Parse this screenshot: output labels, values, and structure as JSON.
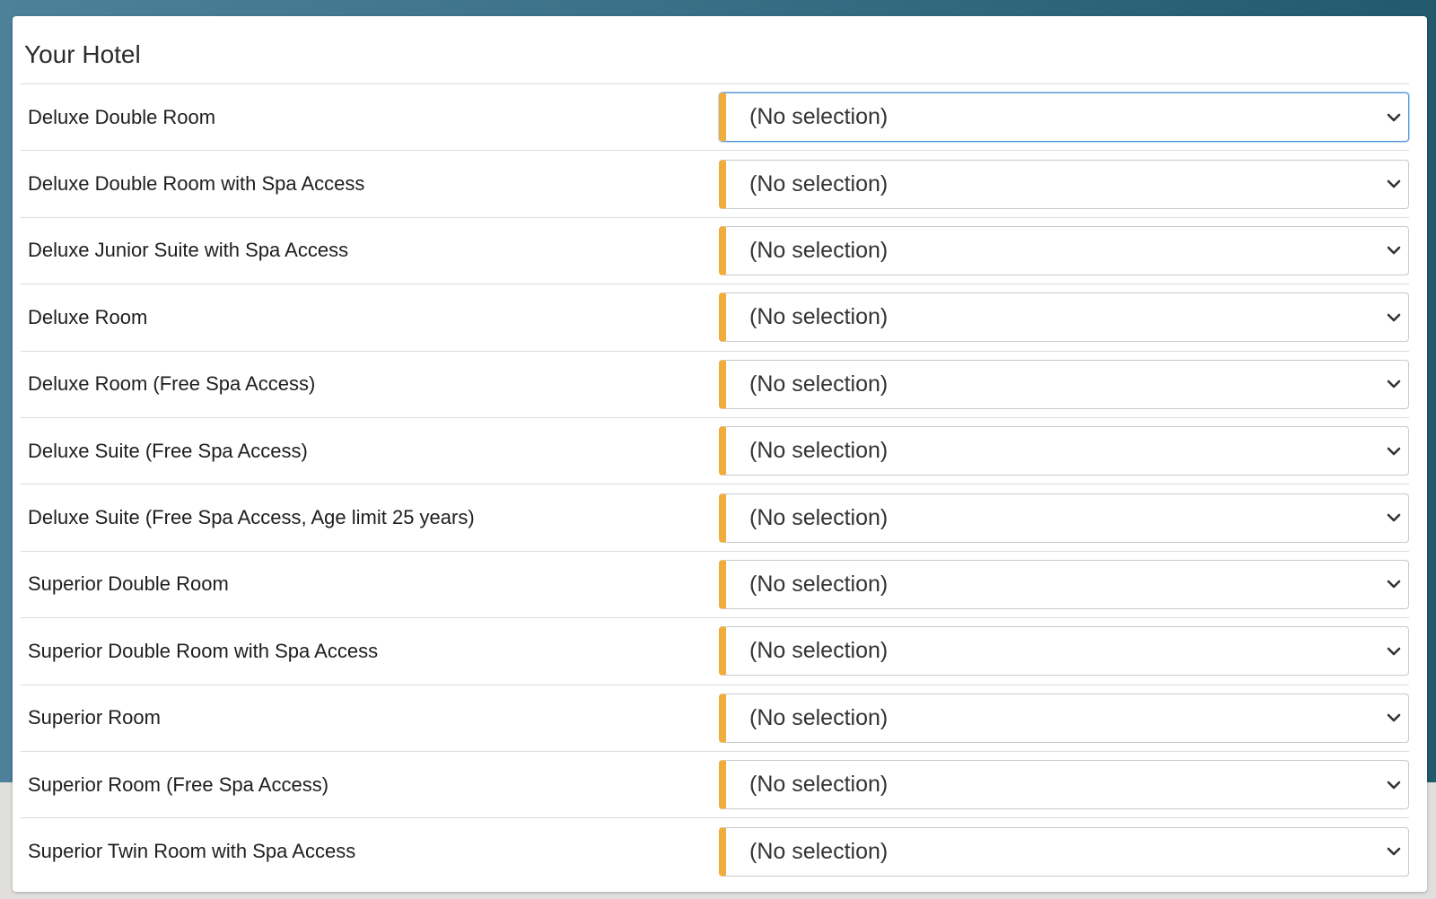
{
  "card": {
    "title": "Your Hotel"
  },
  "rooms": [
    {
      "label": "Deluxe Double Room",
      "selected": "(No selection)"
    },
    {
      "label": "Deluxe Double Room with Spa Access",
      "selected": "(No selection)"
    },
    {
      "label": "Deluxe Junior Suite with Spa Access",
      "selected": "(No selection)"
    },
    {
      "label": "Deluxe Room",
      "selected": "(No selection)"
    },
    {
      "label": "Deluxe Room (Free Spa Access)",
      "selected": "(No selection)"
    },
    {
      "label": "Deluxe Suite (Free Spa Access)",
      "selected": "(No selection)"
    },
    {
      "label": "Deluxe Suite (Free Spa Access, Age limit 25 years)",
      "selected": "(No selection)"
    },
    {
      "label": "Superior Double Room",
      "selected": "(No selection)"
    },
    {
      "label": "Superior Double Room with Spa Access",
      "selected": "(No selection)"
    },
    {
      "label": "Superior Room",
      "selected": "(No selection)"
    },
    {
      "label": "Superior Room (Free Spa Access)",
      "selected": "(No selection)"
    },
    {
      "label": "Superior Twin Room with Spa Access",
      "selected": "(No selection)"
    }
  ],
  "colors": {
    "accent_bar": "#f0ad3c",
    "focus_border": "#4a90d9",
    "background_gradient_start": "#4d8099",
    "background_gradient_end": "#22596d"
  },
  "icons": {
    "select_arrow": "chevron-down-icon"
  }
}
